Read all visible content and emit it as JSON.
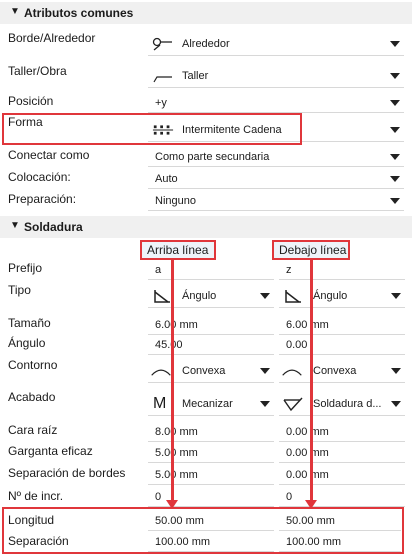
{
  "common": {
    "title": "Atributos comunes",
    "rows": [
      {
        "label": "Borde/Alrededor",
        "value": "Alrededor"
      },
      {
        "label": "Taller/Obra",
        "value": "Taller"
      },
      {
        "label": "Posición",
        "value": "+y"
      },
      {
        "label": "Forma",
        "value": "Intermitente Cadena"
      },
      {
        "label": "Conectar como",
        "value": "Como parte secundaria"
      },
      {
        "label": "Colocación:",
        "value": "Auto"
      },
      {
        "label": "Preparación:",
        "value": "Ninguno"
      }
    ]
  },
  "weld": {
    "title": "Soldadura",
    "col_above": "Arriba línea",
    "col_below": "Debajo línea",
    "rows": {
      "prefix": {
        "label": "Prefijo",
        "above": "a",
        "below": "z"
      },
      "type": {
        "label": "Tipo",
        "above": "Ángulo",
        "below": "Ángulo"
      },
      "size": {
        "label": "Tamaño",
        "above": "6.00 mm",
        "below": "6.00 mm"
      },
      "angle": {
        "label": "Ángulo",
        "above": "45.00",
        "below": "0.00"
      },
      "contour": {
        "label": "Contorno",
        "above": "Convexa",
        "below": "Convexa"
      },
      "finish": {
        "label": "Acabado",
        "above": "Mecanizar",
        "below": "Soldadura d..."
      },
      "root": {
        "label": "Cara raíz",
        "above": "8.00 mm",
        "below": "0.00 mm"
      },
      "throat": {
        "label": "Garganta eficaz",
        "above": "5.00 mm",
        "below": "0.00 mm"
      },
      "edge": {
        "label": "Separación de bordes",
        "above": "5.00 mm",
        "below": "0.00 mm"
      },
      "incr": {
        "label": "Nº de incr.",
        "above": "0",
        "below": "0"
      },
      "length": {
        "label": "Longitud",
        "above": "50.00 mm",
        "below": "50.00 mm"
      },
      "spacing": {
        "label": "Separación",
        "above": "100.00 mm",
        "below": "100.00 mm"
      }
    }
  },
  "colors": {
    "highlight": "#e0363b",
    "header_bg": "#f0f0f0"
  }
}
